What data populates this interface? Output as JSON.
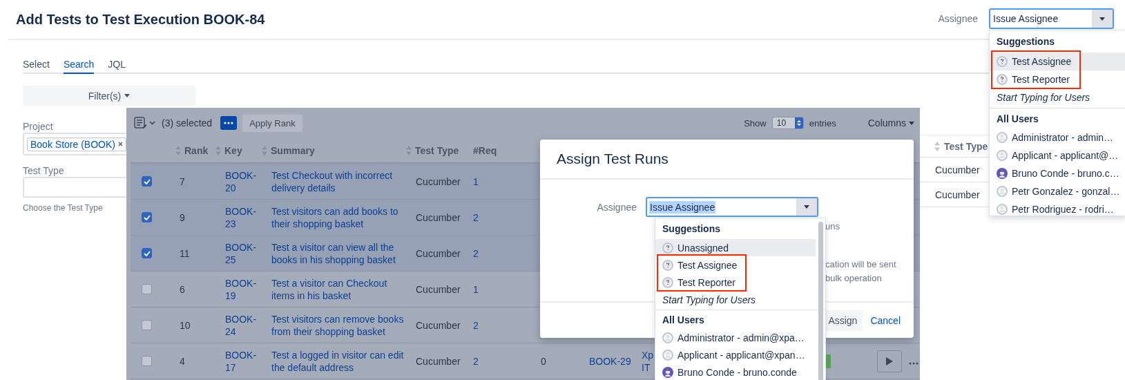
{
  "header": {
    "title": "Add Tests to Test Execution BOOK-84",
    "assignee": {
      "label": "Assignee",
      "value": "Issue Assignee",
      "dropdown": {
        "sections": [
          {
            "heading": "Suggestions",
            "items": [
              {
                "label": "Test Assignee",
                "kind": "unknown",
                "selected": true,
                "annotated": true
              },
              {
                "label": "Test Reporter",
                "kind": "unknown",
                "selected": false,
                "annotated": true
              }
            ],
            "hint": "Start Typing for Users"
          },
          {
            "heading": "All Users",
            "items": [
              {
                "label": "Administrator - admin…",
                "kind": "default",
                "selected": false,
                "annotated": false
              },
              {
                "label": "Applicant - applicant@…",
                "kind": "default",
                "selected": false,
                "annotated": false
              },
              {
                "label": "Bruno Conde - bruno.c…",
                "kind": "photo",
                "selected": false,
                "annotated": false
              },
              {
                "label": "Petr Gonzalez - gonzal…",
                "kind": "default",
                "selected": false,
                "annotated": false
              },
              {
                "label": "Petr Rodriguez - rodri…",
                "kind": "default",
                "selected": false,
                "annotated": false
              }
            ]
          }
        ]
      }
    }
  },
  "tabs": [
    {
      "label": "Select",
      "selected": false
    },
    {
      "label": "Search",
      "selected": true
    },
    {
      "label": "JQL",
      "selected": false
    }
  ],
  "filter_button": "Filter(s)",
  "form": {
    "project": {
      "label": "Project",
      "chips": [
        "Book Store (BOOK)"
      ]
    },
    "test_type": {
      "label": "Test Type",
      "hint": "Choose the Test Type"
    }
  },
  "table": {
    "selected_count": "(3) selected",
    "apply_rank": "Apply Rank",
    "show_label": "Show",
    "page_size": "10",
    "entries_label": "entries",
    "columns_button": "Columns",
    "columns": [
      {
        "label": "Rank",
        "sortable": true
      },
      {
        "label": "Key",
        "sortable": true
      },
      {
        "label": "Summary",
        "sortable": true
      },
      {
        "label": "Test Type",
        "sortable": true
      },
      {
        "label": "#Req",
        "sortable": false
      }
    ],
    "rows": [
      {
        "rank": "7",
        "key": "BOOK-20",
        "summary": "Test Checkout with incorrect delivery details",
        "test_type": "Cucumber",
        "req": "1",
        "selected": true
      },
      {
        "rank": "9",
        "key": "BOOK-23",
        "summary": "Test visitors can add books to their shopping basket",
        "test_type": "Cucumber",
        "req": "2",
        "selected": true
      },
      {
        "rank": "11",
        "key": "BOOK-25",
        "summary": "Test a visitor can view all the books in his shopping basket",
        "test_type": "Cucumber",
        "req": "2",
        "selected": true
      },
      {
        "rank": "6",
        "key": "BOOK-19",
        "summary": "Test a visitor can Checkout items in his basket",
        "test_type": "Cucumber",
        "req": "1",
        "selected": false
      },
      {
        "rank": "10",
        "key": "BOOK-24",
        "summary": "Test visitors can remove books from their shopping basket",
        "test_type": "Cucumber",
        "req": "2",
        "selected": false
      },
      {
        "rank": "4",
        "key": "BOOK-17",
        "summary": "Test a logged in visitor can edit the default address",
        "test_type": "Cucumber",
        "req": "2",
        "selected": false,
        "column_7": "0",
        "column_8": "BOOK-29",
        "column_9": "Xp IT"
      }
    ]
  },
  "side_table": {
    "column": {
      "label": "Test Type",
      "sortable": true
    },
    "rows": [
      "Cucumber",
      "Cucumber"
    ]
  },
  "modal": {
    "title": "Assign Test Runs",
    "assignee_label": "Assignee",
    "assignee_value": "Issue Assignee",
    "value_highlighted": true,
    "notes": [
      "uns",
      "cation will be sent\nbulk operation"
    ],
    "buttons": [
      {
        "label": "Assign",
        "kind": "button"
      },
      {
        "label": "Cancel",
        "kind": "link"
      }
    ],
    "dropdown": {
      "sections": [
        {
          "heading": "Suggestions",
          "items": [
            {
              "label": "Unassigned",
              "kind": "unknown",
              "selected": true,
              "annotated": false
            },
            {
              "label": "Test Assignee",
              "kind": "unknown",
              "selected": false,
              "annotated": true
            },
            {
              "label": "Test Reporter",
              "kind": "unknown",
              "selected": false,
              "annotated": true
            }
          ],
          "hint": "Start Typing for Users"
        },
        {
          "heading": "All Users",
          "items": [
            {
              "label": "Administrator - admin@xpa…",
              "kind": "default",
              "selected": false,
              "annotated": false
            },
            {
              "label": "Applicant - applicant@xpan…",
              "kind": "default",
              "selected": false,
              "annotated": false
            },
            {
              "label": "Bruno Conde - bruno.conde",
              "kind": "photo",
              "selected": false,
              "annotated": false
            }
          ]
        }
      ]
    }
  }
}
